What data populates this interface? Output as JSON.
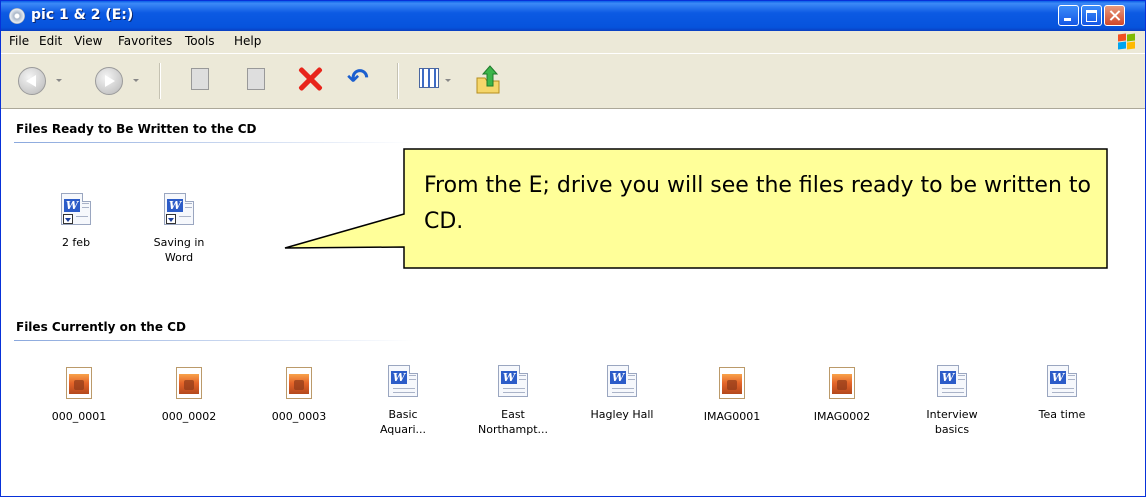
{
  "window": {
    "title": "pic 1 & 2 (E:)",
    "title_icon": "cd-drive-icon",
    "accent": "#0a5fe8"
  },
  "menu": [
    "File",
    "Edit",
    "View",
    "Favorites",
    "Tools",
    "Help"
  ],
  "toolbar": {
    "icons": [
      "back-icon",
      "forward-icon",
      "write-files-icon",
      "copy-files-icon",
      "delete-icon",
      "undo-icon",
      "views-icon",
      "folder-up-icon"
    ]
  },
  "sections": {
    "ready": {
      "title": "Files Ready to Be Written to the CD",
      "files": [
        {
          "label": "2 feb",
          "icon": "word-document-icon"
        },
        {
          "label": "Saving in Word",
          "icon": "word-document-icon"
        }
      ]
    },
    "current": {
      "title": "Files Currently on the CD",
      "files": [
        {
          "label": "000_0001",
          "icon": "image-file-icon"
        },
        {
          "label": "000_0002",
          "icon": "image-file-icon"
        },
        {
          "label": "000_0003",
          "icon": "image-file-icon"
        },
        {
          "label": "Basic Aquari...",
          "icon": "word-document-icon"
        },
        {
          "label": "East Northampt...",
          "icon": "word-document-icon"
        },
        {
          "label": "Hagley Hall",
          "icon": "word-document-icon"
        },
        {
          "label": "IMAG0001",
          "icon": "image-file-icon"
        },
        {
          "label": "IMAG0002",
          "icon": "image-file-icon"
        },
        {
          "label": "Interview basics",
          "icon": "word-document-icon"
        },
        {
          "label": "Tea time",
          "icon": "word-document-icon"
        }
      ]
    }
  },
  "callout": {
    "text": "From the E; drive you will see the files ready to be written to CD.",
    "color": "#ffff99"
  }
}
